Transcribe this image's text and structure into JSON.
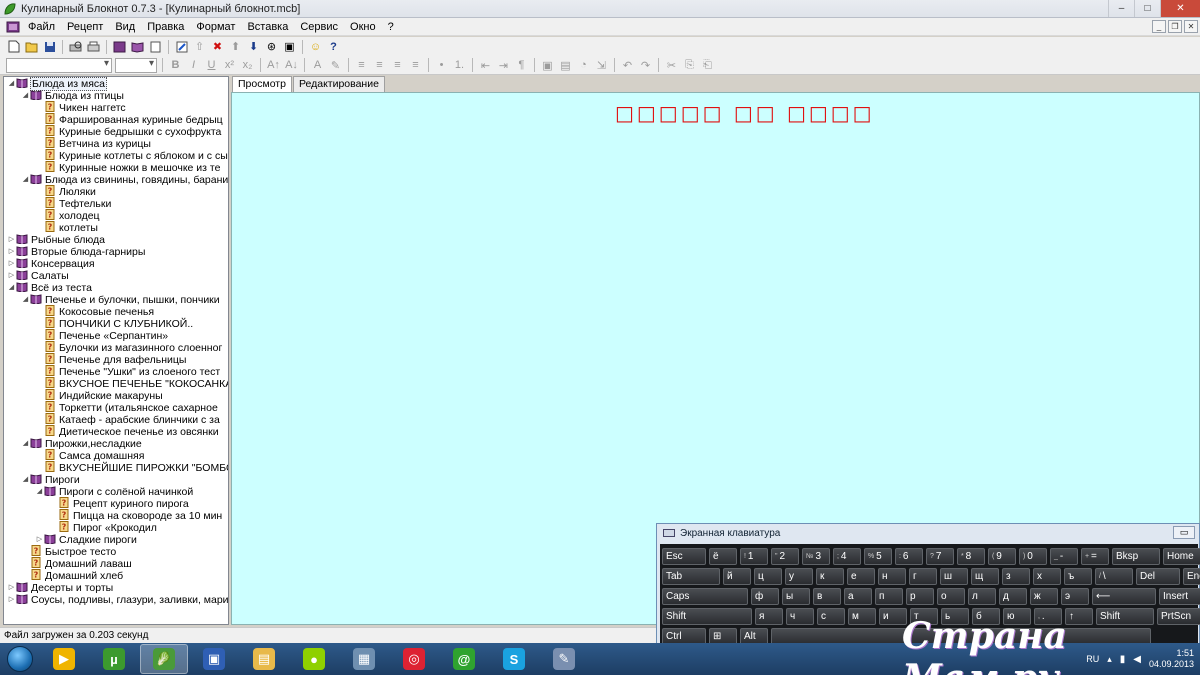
{
  "window": {
    "title": "Кулинарный Блокнот 0.7.3 - [Кулинарный блокнот.mcb]",
    "controls": [
      "–",
      "□",
      "✕"
    ]
  },
  "menubar": {
    "items": [
      "Файл",
      "Рецепт",
      "Вид",
      "Правка",
      "Формат",
      "Вставка",
      "Сервис",
      "Окно",
      "?"
    ],
    "mdi_controls": [
      "_",
      "❐",
      "✕"
    ]
  },
  "toolbar1": {
    "icons": [
      "new-doc",
      "open-folder",
      "save",
      "print-preview",
      "print",
      "book",
      "book-open",
      "page",
      "edit",
      "arrow-up",
      "delete",
      "move-up",
      "move-down",
      "binoculars",
      "image-search",
      "smiley",
      "help"
    ]
  },
  "toolbar2": {
    "icons": [
      "B",
      "I",
      "U",
      "x²",
      "x₂",
      "A↑",
      "A↓",
      "A",
      "✎",
      "≡",
      "≡",
      "≡",
      "≡",
      "•",
      "1.",
      "⇤",
      "⇥",
      "¶",
      "▣",
      "▤",
      "◔",
      "⇲",
      "↶",
      "↷",
      "✂",
      "⎘",
      "⎗"
    ]
  },
  "tree": {
    "rows": [
      {
        "label": "Блюда из мяса",
        "level": 0,
        "type": "book",
        "exp": "◢",
        "selected": true
      },
      {
        "label": "Блюда из птицы",
        "level": 1,
        "type": "book",
        "exp": "◢"
      },
      {
        "label": "Чикен наггетс",
        "level": 2,
        "type": "recipe"
      },
      {
        "label": "Фаршированная куриные бедрыц",
        "level": 2,
        "type": "recipe"
      },
      {
        "label": "Куриные  бедрышки с сухофрукта",
        "level": 2,
        "type": "recipe"
      },
      {
        "label": "Ветчина из курицы",
        "level": 2,
        "type": "recipe"
      },
      {
        "label": "Куриные котлеты с яблоком и с сы",
        "level": 2,
        "type": "recipe"
      },
      {
        "label": "Куринные ножки в мешочке из те",
        "level": 2,
        "type": "recipe"
      },
      {
        "label": "Блюда из свинины, говядины, барани",
        "level": 1,
        "type": "book",
        "exp": "◢"
      },
      {
        "label": "Люляки",
        "level": 2,
        "type": "recipe"
      },
      {
        "label": "Тефтельки",
        "level": 2,
        "type": "recipe"
      },
      {
        "label": "холодец",
        "level": 2,
        "type": "recipe"
      },
      {
        "label": "котлеты",
        "level": 2,
        "type": "recipe"
      },
      {
        "label": "Рыбные блюда",
        "level": 0,
        "type": "book",
        "exp": "▷"
      },
      {
        "label": "Вторые блюда-гарниры",
        "level": 0,
        "type": "book",
        "exp": "▷"
      },
      {
        "label": "Консервация",
        "level": 0,
        "type": "book",
        "exp": "▷"
      },
      {
        "label": "Салаты",
        "level": 0,
        "type": "book",
        "exp": "▷"
      },
      {
        "label": "Всё из теста",
        "level": 0,
        "type": "book",
        "exp": "◢"
      },
      {
        "label": "Печенье и булочки, пышки, пончики",
        "level": 1,
        "type": "book",
        "exp": "◢"
      },
      {
        "label": "Кокосовые печенья",
        "level": 2,
        "type": "recipe"
      },
      {
        "label": "ПОНЧИКИ С КЛУБНИКОЙ..",
        "level": 2,
        "type": "recipe"
      },
      {
        "label": "Печенье «Серпантин»",
        "level": 2,
        "type": "recipe"
      },
      {
        "label": "Булочки из магазинного слоенног",
        "level": 2,
        "type": "recipe"
      },
      {
        "label": "Печенье для вафельницы",
        "level": 2,
        "type": "recipe"
      },
      {
        "label": "Печенье \"Ушки\" из слоеного тест",
        "level": 2,
        "type": "recipe"
      },
      {
        "label": "ВКУСНОЕ ПЕЧЕНЬЕ \"КОКОСАНКА\"",
        "level": 2,
        "type": "recipe"
      },
      {
        "label": "Индийские макаруны",
        "level": 2,
        "type": "recipe"
      },
      {
        "label": "Торкетти (итальянское сахарное",
        "level": 2,
        "type": "recipe"
      },
      {
        "label": "Катаеф - арабские блинчики с за",
        "level": 2,
        "type": "recipe"
      },
      {
        "label": "Диетическое печенье из овсянки",
        "level": 2,
        "type": "recipe"
      },
      {
        "label": "Пирожки,несладкие",
        "level": 1,
        "type": "book",
        "exp": "◢"
      },
      {
        "label": "Самса домашняя",
        "level": 2,
        "type": "recipe"
      },
      {
        "label": "ВКУСНЕЙШИЕ ПИРОЖКИ \"БОМБОЧ",
        "level": 2,
        "type": "recipe"
      },
      {
        "label": "Пироги",
        "level": 1,
        "type": "book",
        "exp": "◢"
      },
      {
        "label": "Пироги с солёной начинкой",
        "level": 2,
        "type": "book",
        "exp": "◢"
      },
      {
        "label": "Рецепт куриного пирога",
        "level": 3,
        "type": "recipe"
      },
      {
        "label": "Пицца на сковороде за 10 мин",
        "level": 3,
        "type": "recipe"
      },
      {
        "label": "Пирог «Крокодил",
        "level": 3,
        "type": "recipe"
      },
      {
        "label": "Сладкие пироги",
        "level": 2,
        "type": "book",
        "exp": "▷"
      },
      {
        "label": "Быстрое тесто",
        "level": 1,
        "type": "recipe"
      },
      {
        "label": "Домашний лаваш",
        "level": 1,
        "type": "recipe"
      },
      {
        "label": "Домашний хлеб",
        "level": 1,
        "type": "recipe"
      },
      {
        "label": "Десерты и торты",
        "level": 0,
        "type": "book",
        "exp": "▷"
      },
      {
        "label": "Соусы, подливы, глазури, заливки, мари",
        "level": 0,
        "type": "book",
        "exp": "▷"
      }
    ]
  },
  "tabs": [
    "Просмотр",
    "Редактирование"
  ],
  "view": {
    "title_glyphs": "□□□□□ □□ □□□□"
  },
  "statusbar": {
    "text": "Файл загружен за 0.203 секунд"
  },
  "keyboard": {
    "title": "Экранная клавиатура",
    "min_label": "▭",
    "rows": [
      [
        [
          "Esc",
          ""
        ],
        [
          "ё",
          ""
        ],
        [
          "1",
          "!"
        ],
        [
          "2",
          "\""
        ],
        [
          "3",
          "№"
        ],
        [
          "4",
          ";"
        ],
        [
          "5",
          "%"
        ],
        [
          "6",
          ":"
        ],
        [
          "7",
          "?"
        ],
        [
          "8",
          "*"
        ],
        [
          "9",
          "("
        ],
        [
          "0",
          ")"
        ],
        [
          "-",
          "_"
        ],
        [
          "=",
          "+"
        ],
        [
          "Bksp",
          ""
        ],
        [
          "Home",
          ""
        ]
      ],
      [
        [
          "Tab",
          ""
        ],
        [
          "й",
          ""
        ],
        [
          "ц",
          ""
        ],
        [
          "у",
          ""
        ],
        [
          "к",
          ""
        ],
        [
          "е",
          ""
        ],
        [
          "н",
          ""
        ],
        [
          "г",
          ""
        ],
        [
          "ш",
          ""
        ],
        [
          "щ",
          ""
        ],
        [
          "з",
          ""
        ],
        [
          "х",
          ""
        ],
        [
          "ъ",
          ""
        ],
        [
          "\\",
          "/"
        ],
        [
          "Del",
          ""
        ],
        [
          "End",
          ""
        ]
      ],
      [
        [
          "Caps",
          ""
        ],
        [
          "ф",
          ""
        ],
        [
          "ы",
          ""
        ],
        [
          "в",
          ""
        ],
        [
          "а",
          ""
        ],
        [
          "п",
          ""
        ],
        [
          "р",
          ""
        ],
        [
          "о",
          ""
        ],
        [
          "л",
          ""
        ],
        [
          "д",
          ""
        ],
        [
          "ж",
          ""
        ],
        [
          "э",
          ""
        ],
        [
          "⟵",
          ""
        ],
        [
          "Insert",
          ""
        ]
      ],
      [
        [
          "Shift",
          ""
        ],
        [
          "я",
          ""
        ],
        [
          "ч",
          ""
        ],
        [
          "с",
          ""
        ],
        [
          "м",
          ""
        ],
        [
          "и",
          ""
        ],
        [
          "т",
          ""
        ],
        [
          "ь",
          ""
        ],
        [
          "б",
          ""
        ],
        [
          "ю",
          ""
        ],
        [
          ".",
          ","
        ],
        [
          "↑",
          ""
        ],
        [
          "Shift",
          ""
        ],
        [
          "PrtScn",
          ""
        ]
      ],
      [
        [
          "Ctrl",
          ""
        ],
        [
          "⊞",
          ""
        ],
        [
          "Alt",
          ""
        ],
        [
          "",
          ""
        ]
      ]
    ]
  },
  "taskbar": {
    "items": [
      {
        "name": "start",
        "glyph": ""
      },
      {
        "name": "media-player",
        "glyph": "▶",
        "color": "#f0b400"
      },
      {
        "name": "utorrent",
        "glyph": "µ",
        "color": "#3c9a2e"
      },
      {
        "name": "culinary-notebook",
        "glyph": "🥬",
        "color": "#4a9a3a",
        "active": true
      },
      {
        "name": "floppy-save",
        "glyph": "▣",
        "color": "#2f5fb4"
      },
      {
        "name": "explorer",
        "glyph": "▤",
        "color": "#e8b94a"
      },
      {
        "name": "app-green",
        "glyph": "●",
        "color": "#8fd000"
      },
      {
        "name": "network",
        "glyph": "▦",
        "color": "#6f8fb0"
      },
      {
        "name": "chrome",
        "glyph": "◎",
        "color": "#d23"
      },
      {
        "name": "mail-agent",
        "glyph": "@",
        "color": "#2fa32f"
      },
      {
        "name": "skype",
        "glyph": "S",
        "color": "#1aa2e0"
      },
      {
        "name": "paint",
        "glyph": "✎",
        "color": "#7a8fb0"
      }
    ],
    "lang": "RU",
    "time": "1:51",
    "date": "04.09.2013"
  },
  "watermark": "Страна Мам.ру",
  "colors": {
    "view_bg": "#ccffff",
    "title_red": "#e01010",
    "selected_bg": "#eef3fb"
  }
}
